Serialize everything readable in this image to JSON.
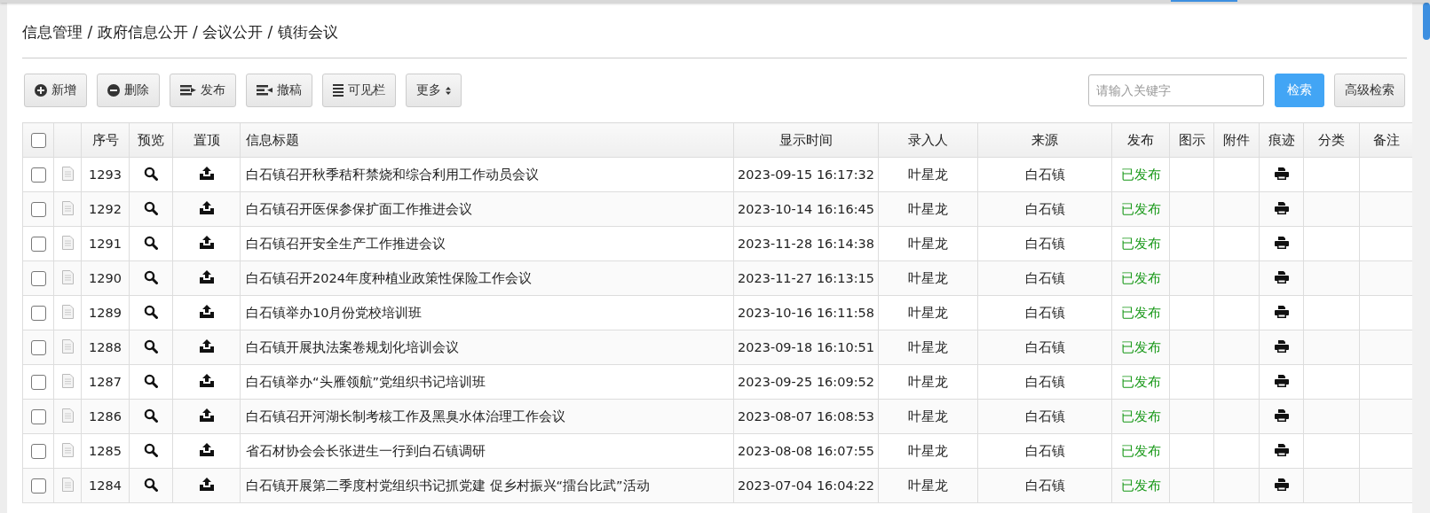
{
  "breadcrumb": "信息管理 / 政府信息公开 / 会议公开 / 镇街会议",
  "toolbar": [
    {
      "kind": "add",
      "label": "新增"
    },
    {
      "kind": "delete",
      "label": "删除"
    },
    {
      "kind": "publish",
      "label": "发布"
    },
    {
      "kind": "withdraw",
      "label": "撤稿"
    },
    {
      "kind": "columns",
      "label": "可见栏"
    },
    {
      "kind": "more",
      "label": "更多"
    }
  ],
  "search": {
    "placeholder": "请输入关键字",
    "button": "检索",
    "advanced": "高级检索"
  },
  "table": {
    "select_all": {
      "checked": false
    },
    "columns": [
      "序号",
      "预览",
      "置顶",
      "信息标题",
      "显示时间",
      "录入人",
      "来源",
      "发布",
      "图示",
      "附件",
      "痕迹",
      "分类",
      "备注"
    ],
    "rows": [
      {
        "checked": false,
        "id": "1293",
        "title": "白石镇召开秋季秸秆禁烧和综合利用工作动员会议",
        "time": "2023-09-15 16:17:32",
        "author": "叶星龙",
        "source": "白石镇",
        "status": {
          "kind": "published",
          "text": "已发布"
        }
      },
      {
        "checked": false,
        "id": "1292",
        "title": "白石镇召开医保参保扩面工作推进会议",
        "time": "2023-10-14 16:16:45",
        "author": "叶星龙",
        "source": "白石镇",
        "status": {
          "kind": "published",
          "text": "已发布"
        }
      },
      {
        "checked": false,
        "id": "1291",
        "title": "白石镇召开安全生产工作推进会议",
        "time": "2023-11-28 16:14:38",
        "author": "叶星龙",
        "source": "白石镇",
        "status": {
          "kind": "published",
          "text": "已发布"
        }
      },
      {
        "checked": false,
        "id": "1290",
        "title": "白石镇召开2024年度种植业政策性保险工作会议",
        "time": "2023-11-27 16:13:15",
        "author": "叶星龙",
        "source": "白石镇",
        "status": {
          "kind": "published",
          "text": "已发布"
        }
      },
      {
        "checked": false,
        "id": "1289",
        "title": "白石镇举办10月份党校培训班",
        "time": "2023-10-16 16:11:58",
        "author": "叶星龙",
        "source": "白石镇",
        "status": {
          "kind": "published",
          "text": "已发布"
        }
      },
      {
        "checked": false,
        "id": "1288",
        "title": "白石镇开展执法案卷规划化培训会议",
        "time": "2023-09-18 16:10:51",
        "author": "叶星龙",
        "source": "白石镇",
        "status": {
          "kind": "published",
          "text": "已发布"
        }
      },
      {
        "checked": false,
        "id": "1287",
        "title": "白石镇举办“头雁领航”党组织书记培训班",
        "time": "2023-09-25 16:09:52",
        "author": "叶星龙",
        "source": "白石镇",
        "status": {
          "kind": "published",
          "text": "已发布"
        }
      },
      {
        "checked": false,
        "id": "1286",
        "title": "白石镇召开河湖长制考核工作及黑臭水体治理工作会议",
        "time": "2023-08-07 16:08:53",
        "author": "叶星龙",
        "source": "白石镇",
        "status": {
          "kind": "published",
          "text": "已发布"
        }
      },
      {
        "checked": false,
        "id": "1285",
        "title": "省石材协会会长张进生一行到白石镇调研",
        "time": "2023-08-08 16:07:55",
        "author": "叶星龙",
        "source": "白石镇",
        "status": {
          "kind": "published",
          "text": "已发布"
        }
      },
      {
        "checked": false,
        "id": "1284",
        "title": "白石镇开展第二季度村党组织书记抓党建 促乡村振兴“擂台比武”活动",
        "time": "2023-07-04 16:04:22",
        "author": "叶星龙",
        "source": "白石镇",
        "status": {
          "kind": "published",
          "text": "已发布"
        }
      }
    ]
  }
}
